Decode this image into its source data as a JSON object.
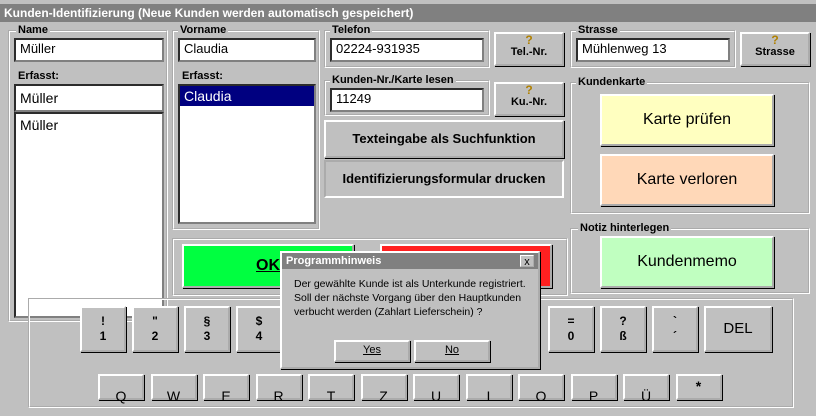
{
  "window": {
    "title": "Kunden-Identifizierung (Neue Kunden werden automatisch gespeichert)"
  },
  "name": {
    "label": "Name",
    "value": "Müller",
    "erfasst_label": "Erfasst:",
    "erfasst_value": "Müller",
    "list": [
      "Müller"
    ]
  },
  "vorname": {
    "label": "Vorname",
    "value": "Claudia",
    "erfasst_label": "Erfasst:",
    "list": [
      "Claudia"
    ]
  },
  "telefon": {
    "label": "Telefon",
    "value": "02224-931935",
    "button": "Tel.-Nr."
  },
  "strasse": {
    "label": "Strasse",
    "value": "Mühlenweg 13",
    "button": "Strasse"
  },
  "kundennr": {
    "label": "Kunden-Nr./Karte lesen",
    "value": "11249",
    "button": "Ku.-Nr."
  },
  "actions": {
    "texteingabe": "Texteingabe als Suchfunktion",
    "drucken": "Identifizierungsformular drucken"
  },
  "kundenkarte": {
    "label": "Kundenkarte",
    "pruefen": "Karte prüfen",
    "verloren": "Karte verloren"
  },
  "notiz": {
    "label": "Notiz hinterlegen",
    "memo": "Kundenmemo"
  },
  "ok": {
    "label": "OK"
  },
  "keyboard": {
    "row1": [
      {
        "top": "!",
        "bottom": "1"
      },
      {
        "top": "\"",
        "bottom": "2"
      },
      {
        "top": "§",
        "bottom": "3"
      },
      {
        "top": "$",
        "bottom": "4"
      },
      {
        "top": "=",
        "bottom": "0"
      },
      {
        "top": "?",
        "bottom": "ß"
      },
      {
        "top": "`",
        "bottom": "´"
      }
    ],
    "del": "DEL",
    "row2": [
      "Q",
      "W",
      "E",
      "R",
      "T",
      "Z",
      "U",
      "I",
      "O",
      "P",
      "Ü",
      "*"
    ]
  },
  "dialog": {
    "title": "Programmhinweis",
    "close": "x",
    "lines": [
      "Der gewählte Kunde ist als Unterkunde registriert.",
      "Soll der nächste Vorgang über den Hauptkunden",
      "verbucht werden (Zahlart Lieferschein) ?"
    ],
    "yes": "Yes",
    "no": "No"
  },
  "colors": {
    "ok": "#00ff40",
    "cancel": "#ff2020",
    "pruefen": "#ffffc0",
    "verloren": "#ffd8b8",
    "memo": "#c0ffc0",
    "selection": "#000080"
  }
}
